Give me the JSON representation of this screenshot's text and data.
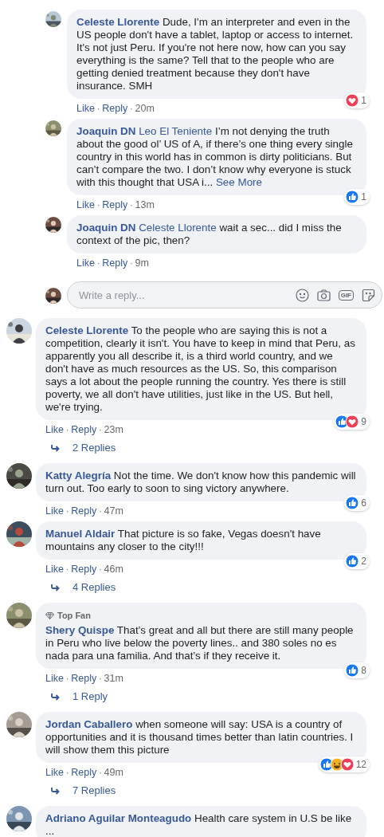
{
  "thread": [
    {
      "kind": "reply_comment",
      "name": "Celeste Llorente",
      "body": "Dude, I'm an interpreter and even in the US people don't have a tablet, laptop or access to internet. It's not just Peru. If you're not here now, how can you say everything is the same? Tell that to the people who are getting denied treatment because they don't have insurance. SMH",
      "reactions": {
        "types": [
          {
            "kind": "love"
          }
        ],
        "count": "1"
      },
      "actions": [
        {
          "kind": "link",
          "text": "Like"
        },
        {
          "kind": "sep",
          "text": "·"
        },
        {
          "kind": "link",
          "text": "Reply"
        },
        {
          "kind": "sep",
          "text": "·"
        },
        {
          "kind": "time",
          "text": "20m"
        }
      ]
    },
    {
      "kind": "reply_comment",
      "name": "Joaquin DN",
      "mention": "Leo El Teniente",
      "body": "I’m not denying the truth about the good ol’ US of A, if there’s one thing every single country in this world has in common is dirty politicians. But can’t compare the two. I don’t know why everyone is stuck with this thought that USA i...",
      "see_more": "See More",
      "reactions": {
        "types": [
          {
            "kind": "like"
          }
        ],
        "count": "1"
      },
      "actions": [
        {
          "kind": "link",
          "text": "Like"
        },
        {
          "kind": "sep",
          "text": "·"
        },
        {
          "kind": "link",
          "text": "Reply"
        },
        {
          "kind": "sep",
          "text": "·"
        },
        {
          "kind": "time",
          "text": "13m"
        }
      ]
    },
    {
      "kind": "reply_comment",
      "name": "Joaquin DN",
      "mention": "Celeste Llorente",
      "body": "wait a sec... did I miss the context of the pic, then?",
      "actions": [
        {
          "kind": "link",
          "text": "Like"
        },
        {
          "kind": "sep",
          "text": "·"
        },
        {
          "kind": "link",
          "text": "Reply"
        },
        {
          "kind": "sep",
          "text": "·"
        },
        {
          "kind": "time",
          "text": "9m"
        }
      ]
    },
    {
      "kind": "composer",
      "placeholder": "Write a reply...",
      "gif": "GIF"
    },
    {
      "kind": "top_comment",
      "name": "Celeste Llorente",
      "body": "To the people who are saying this is not a competition, clearly it isn't. You have to keep in mind that Peru, as apparently you all describe it, is a third world country, and we don't have as much resources as the US. So, this comparison says a lot about the people running the country. Yes there is still poverty, we all don't have utilities, just like in the US. But hell, we're trying.",
      "reactions": {
        "types": [
          {
            "kind": "like"
          },
          {
            "kind": "love"
          }
        ],
        "count": "9"
      },
      "actions": [
        {
          "kind": "link",
          "text": "Like"
        },
        {
          "kind": "sep",
          "text": "·"
        },
        {
          "kind": "link",
          "text": "Reply"
        },
        {
          "kind": "sep",
          "text": "·"
        },
        {
          "kind": "time",
          "text": "23m"
        }
      ]
    },
    {
      "kind": "replies",
      "text": "2 Replies"
    },
    {
      "kind": "top_comment",
      "name": "Katty Alegría",
      "body": "Not the time. We don't know how this pandemic will turn out. Too early to soon to sing victory anywhere.",
      "reactions": {
        "types": [
          {
            "kind": "like"
          }
        ],
        "count": "6"
      },
      "actions": [
        {
          "kind": "link",
          "text": "Like"
        },
        {
          "kind": "sep",
          "text": "·"
        },
        {
          "kind": "link",
          "text": "Reply"
        },
        {
          "kind": "sep",
          "text": "·"
        },
        {
          "kind": "time",
          "text": "47m"
        }
      ]
    },
    {
      "kind": "top_comment",
      "name": "Manuel Aldair",
      "body": "That picture is so fake, Vegas doesn't have mountains any closer to the city!!!",
      "reactions": {
        "types": [
          {
            "kind": "like"
          }
        ],
        "count": "2"
      },
      "actions": [
        {
          "kind": "link",
          "text": "Like"
        },
        {
          "kind": "sep",
          "text": "·"
        },
        {
          "kind": "link",
          "text": "Reply"
        },
        {
          "kind": "sep",
          "text": "·"
        },
        {
          "kind": "time",
          "text": "46m"
        }
      ]
    },
    {
      "kind": "replies",
      "text": "4 Replies"
    },
    {
      "kind": "top_comment",
      "badge": "Top Fan",
      "name": "Shery Quispe",
      "body": "That’s great and all but there are still many people in Peru who live below the poverty lines.. and 380 soles no es nada para una familia. And that’s if they receive it.",
      "reactions": {
        "types": [
          {
            "kind": "like"
          }
        ],
        "count": "8"
      },
      "actions": [
        {
          "kind": "link",
          "text": "Like"
        },
        {
          "kind": "sep",
          "text": "·"
        },
        {
          "kind": "link",
          "text": "Reply"
        },
        {
          "kind": "sep",
          "text": "·"
        },
        {
          "kind": "time",
          "text": "31m"
        }
      ]
    },
    {
      "kind": "replies",
      "text": "1 Reply"
    },
    {
      "kind": "top_comment",
      "name": "Jordan Caballero",
      "body": "when someone will say: USA is a country of opportunities and it is thousand times better than latin countries. I will show them this picture",
      "reactions": {
        "types": [
          {
            "kind": "like"
          },
          {
            "kind": "haha"
          },
          {
            "kind": "love"
          }
        ],
        "count": "12"
      },
      "actions": [
        {
          "kind": "link",
          "text": "Like"
        },
        {
          "kind": "sep",
          "text": "·"
        },
        {
          "kind": "link",
          "text": "Reply"
        },
        {
          "kind": "sep",
          "text": "·"
        },
        {
          "kind": "time",
          "text": "49m"
        }
      ]
    },
    {
      "kind": "replies",
      "text": "7 Replies"
    },
    {
      "kind": "top_comment",
      "name": "Adriano Aguilar Monteagudo",
      "body": "Health care system in U.S be like ..."
    }
  ]
}
